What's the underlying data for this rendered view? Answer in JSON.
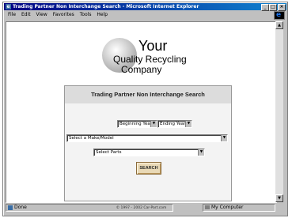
{
  "window": {
    "title": "Trading Partner Non Interchange Search - Microsoft Internet Explorer",
    "buttons": [
      "_",
      "□",
      "×"
    ]
  },
  "menu": [
    "File",
    "Edit",
    "View",
    "Favorites",
    "Tools",
    "Help"
  ],
  "logo": {
    "line1": "Your",
    "line2": "Quality Recycling",
    "line3": "Company"
  },
  "search_form": {
    "header": "Trading Partner Non Interchange Search",
    "beginning_year": "Beginning Year",
    "ending_year": "Ending Year",
    "make_model": "Select a Make/Model",
    "parts": "Select Parts",
    "search_label": "SEARCH"
  },
  "footer": {
    "copyright": "© 1997 - 2002 Car-Part.com"
  },
  "status": {
    "left": "Done",
    "zone": "My Computer"
  },
  "icons": {
    "app": "ie-icon",
    "brand": "internet-explorer-logo"
  },
  "colors": {
    "titlebar": "#000080",
    "chrome": "#c0c0c0",
    "panel_header": "#dcdcdc",
    "panel_body": "#f3f3f3",
    "search_button": "#e9d9b6"
  }
}
